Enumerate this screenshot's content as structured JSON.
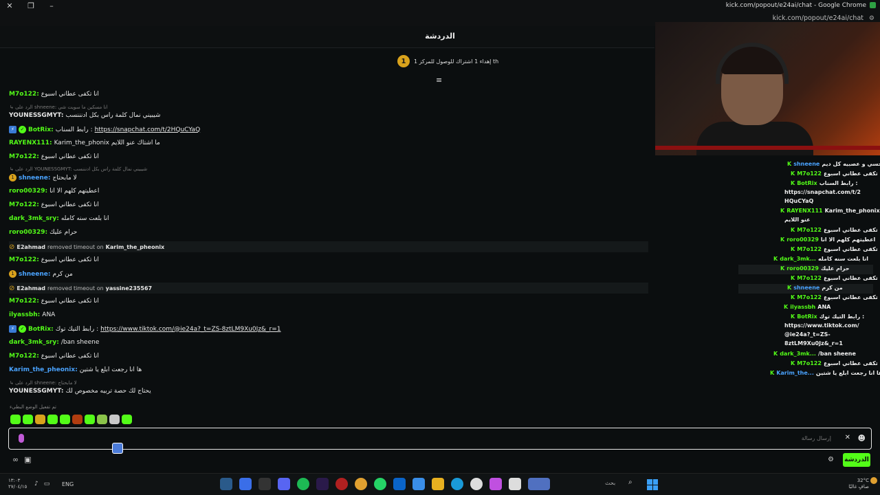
{
  "window": {
    "title": "kick.com/popout/e24ai/chat - Google Chrome",
    "url": "kick.com/popout/e24ai/chat"
  },
  "chat": {
    "title": "الدردشة",
    "goal_badge": "1",
    "goal_text": "إهداء 1 اشتراك للوصول للمركز 1 th"
  },
  "messages": [
    {
      "user": "M7o122",
      "color": "#53fc18",
      "text": "انا تكفى عطاني اسبوع"
    },
    {
      "reply": "الرد على shneene: انا مسكين ما سويت شي"
    },
    {
      "user": "YOUNESSGMYT",
      "color": "#e8e8e8",
      "text": "شيبيني نمال كلمة راس بكل ادنننسب"
    },
    {
      "user": "BotRix",
      "color": "#53fc18",
      "text": "رابط السناب : ",
      "link": "https://snapchat.com/t/2HQuCYaQ"
    },
    {
      "user": "RAYENX111",
      "color": "#53fc18",
      "text": "Karim_the_phonix ما اشتاك عنو اللايم"
    },
    {
      "user": "M7o122",
      "color": "#53fc18",
      "text": "انا تكفى عطاني اسبوع"
    },
    {
      "reply": "الرد على YOUNESSGMYT: شيبيني نمال كلمة راس بكل ادنننسب"
    },
    {
      "user": "shneene",
      "color": "#4aa3ff",
      "text": "لا مابحتاج"
    },
    {
      "user": "roro00329",
      "color": "#53fc18",
      "text": "اعطيتهم كلهم الا انا"
    },
    {
      "user": "M7o122",
      "color": "#53fc18",
      "text": "انا تكفى عطاني اسبوع"
    },
    {
      "user": "dark_3mk_sry",
      "color": "#53fc18",
      "text": "انا بلعت سنه كامله"
    },
    {
      "user": "roro00329",
      "color": "#53fc18",
      "text": "حرام عليك"
    },
    {
      "sys_user": "E2ahmad",
      "sys_text": "removed timeout on",
      "sys_target": "Karim_the_pheonix"
    },
    {
      "user": "M7o122",
      "color": "#53fc18",
      "text": "انا تكفى عطاني اسبوع"
    },
    {
      "user": "shneene",
      "color": "#4aa3ff",
      "text": "من كرم"
    },
    {
      "sys_user": "E2ahmad",
      "sys_text": "removed timeout on",
      "sys_target": "yassine235567"
    },
    {
      "user": "M7o122",
      "color": "#53fc18",
      "text": "انا تكفى عطاني اسبوع"
    },
    {
      "user": "ilyassbh",
      "color": "#53fc18",
      "text": "ANA"
    },
    {
      "user": "BotRix",
      "color": "#53fc18",
      "text": "رابط التيك توك : ",
      "link": "https://www.tiktok.com/@ie24a?_t=ZS-8ztLM9Xu0Jz&_r=1"
    },
    {
      "user": "dark_3mk_sry",
      "color": "#53fc18",
      "text": "/ban sheene"
    },
    {
      "user": "M7o122",
      "color": "#53fc18",
      "text": "انا تكفى عطاني اسبوع"
    },
    {
      "user": "Karim_the_pheonix",
      "color": "#4aa3ff",
      "text": "ها انا رجعت ابلع يا شتين"
    },
    {
      "reply": "الرد على shneene: لا مابحتاج"
    },
    {
      "user": "YOUNESSGMYT",
      "color": "#e8e8e8",
      "text": "يحتاج لك حصة تربيه مخصوص لك"
    }
  ],
  "slow_mode_note": "تم تفعيل الوضع البطيء",
  "input": {
    "placeholder": "إرسال رسالة",
    "send_label": "الدردشة"
  },
  "side_chat": [
    {
      "user": "shneene",
      "text": "انا شي حفظت حسي و عصبيه كل ديم"
    },
    {
      "user": "M7o122",
      "text": "انا تكفى عطاني اسبوع"
    },
    {
      "user": "BotRix",
      "text": "رابط السناب :"
    },
    {
      "user": "",
      "text": "https://snapchat.com/t/2"
    },
    {
      "user": "",
      "text": "HQuCYaQ"
    },
    {
      "user": "RAYENX111",
      "text": "Karim_the_phonix ما اشتاك"
    },
    {
      "user": "",
      "text": "عنو اللايم"
    },
    {
      "user": "M7o122",
      "text": "انا تكفى عطاني اسبوع"
    },
    {
      "user": "roro00329",
      "text": "اعطيتهم كلهم الا انا"
    },
    {
      "user": "M7o122",
      "text": "انا تكفى عطاني اسبوع"
    },
    {
      "user": "dark_3mk...",
      "text": "انا بلعت سنه كامله"
    },
    {
      "user": "roro00329",
      "text": "حرام عليك"
    },
    {
      "user": "M7o122",
      "text": "انا تكفى عطاني اسبوع"
    },
    {
      "user": "shneene",
      "text": "من كرم"
    },
    {
      "user": "M7o122",
      "text": "انا تكفى عطاني اسبوع"
    },
    {
      "user": "ilyassbh",
      "text": "ANA"
    },
    {
      "user": "BotRix",
      "text": "رابط التيك توك :"
    },
    {
      "user": "",
      "text": "https://www.tiktok.com/"
    },
    {
      "user": "",
      "text": "@ie24a?_t=ZS-"
    },
    {
      "user": "",
      "text": "8ztLM9Xu0Jz&_r=1"
    },
    {
      "user": "dark_3mk...",
      "text": "/ban sheene"
    },
    {
      "user": "M7o122",
      "text": "انا تكفى عطاني اسبوع"
    },
    {
      "user": "Karim_the...",
      "text": "ها انا رجعت ابلع يا شتين"
    }
  ],
  "taskbar": {
    "time": "١٣:٠٣",
    "date": "٢٧/٠٤/١٥",
    "lang": "ENG",
    "search": "بحث",
    "temp": "32°C",
    "weather": "صافٍ غالبًا"
  },
  "colors": {
    "accent": "#53fc18",
    "background": "#0b0e0f"
  }
}
